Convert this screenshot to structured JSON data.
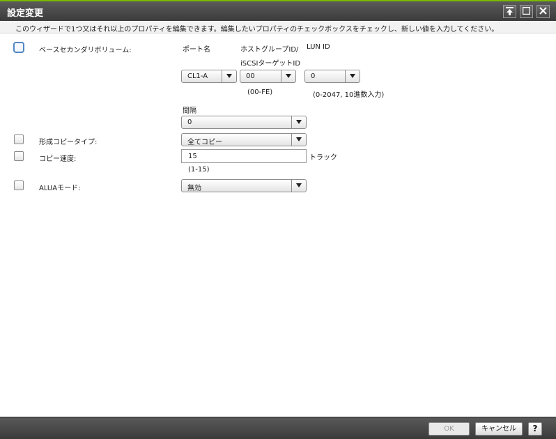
{
  "window": {
    "title": "設定変更"
  },
  "description": "このウィザードで1つ又はそれ以上のプロパティを編集できます。編集したいプロパティのチェックボックスをチェックし、新しい値を入力してください。",
  "base_secondary": {
    "label": "ベースセカンダリボリューム:",
    "col_port": "ポート名",
    "col_host_line1": "ホストグループID/",
    "col_host_line2": "iSCSIターゲットID",
    "col_lun": "LUN ID",
    "port_value": "CL1-A",
    "host_value": "00",
    "host_hint": "(00-FE)",
    "lun_value": "0",
    "lun_hint": "(0-2047, 10進数入力)",
    "interval_label": "間隔",
    "interval_value": "0"
  },
  "copy_type": {
    "label": "形成コピータイプ:",
    "value": "全てコピー"
  },
  "copy_speed": {
    "label": "コピー速度:",
    "value": "15",
    "unit": "トラック",
    "hint": "(1-15)"
  },
  "alua": {
    "label": "ALUAモード:",
    "value": "無効"
  },
  "footer": {
    "ok": "OK",
    "cancel": "キャンセル",
    "help": "?"
  }
}
